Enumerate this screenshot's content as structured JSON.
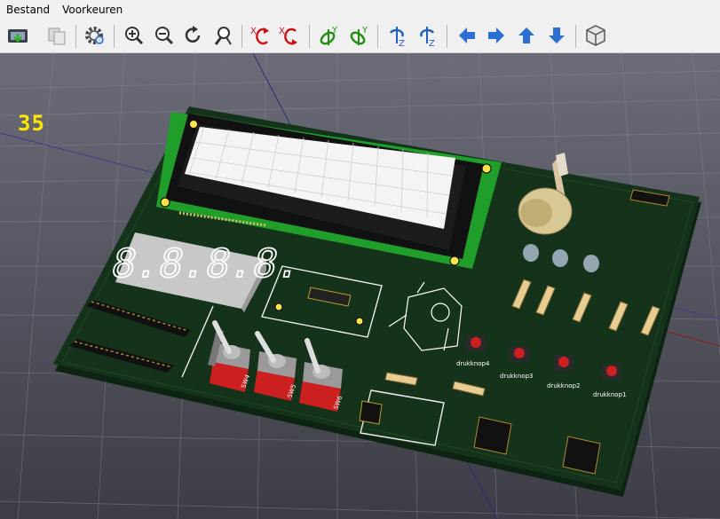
{
  "menu": {
    "items": [
      "Bestand",
      "Voorkeuren"
    ]
  },
  "toolbar": {
    "buttons": [
      {
        "name": "export-image-button",
        "icon": "export-image-icon"
      },
      {
        "name": "copy-button",
        "icon": "copy-icon"
      },
      {
        "name": "settings-button",
        "icon": "gear-icon"
      },
      {
        "name": "zoom-in-button",
        "icon": "zoom-in-icon"
      },
      {
        "name": "zoom-out-icon",
        "icon": "zoom-out-icon"
      },
      {
        "name": "redraw-button",
        "icon": "redraw-icon"
      },
      {
        "name": "zoom-fit-button",
        "icon": "zoom-fit-icon"
      },
      {
        "name": "rotate-x-cw-button",
        "icon": "rotate-x-cw-icon"
      },
      {
        "name": "rotate-x-ccw-button",
        "icon": "rotate-x-ccw-icon"
      },
      {
        "name": "rotate-y-cw-button",
        "icon": "rotate-y-cw-icon"
      },
      {
        "name": "rotate-y-ccw-button",
        "icon": "rotate-y-ccw-icon"
      },
      {
        "name": "rotate-z-cw-button",
        "icon": "rotate-z-cw-icon"
      },
      {
        "name": "rotate-z-ccw-button",
        "icon": "rotate-z-ccw-icon"
      },
      {
        "name": "move-left-button",
        "icon": "arrow-left-icon"
      },
      {
        "name": "move-right-button",
        "icon": "arrow-right-icon"
      },
      {
        "name": "move-up-button",
        "icon": "arrow-up-icon"
      },
      {
        "name": "move-down-button",
        "icon": "arrow-down-icon"
      },
      {
        "name": "ortho-view-button",
        "icon": "cube-icon"
      }
    ],
    "axis_letters": {
      "x": "X",
      "y": "Y",
      "z": "Z"
    }
  },
  "viewport": {
    "fps": "35",
    "seven_segment_text": "8.8.8.8.",
    "silkscreen_labels": [
      "drukknop4",
      "drukknop3",
      "drukknop2",
      "drukknop1",
      "SW4",
      "SW5",
      "SW6"
    ],
    "colors": {
      "background": "#585a66",
      "board": "#15321b",
      "lcd_pcb": "#1f9e2a",
      "silkscreen": "#ffffff",
      "button_cap": "#cc1f1f",
      "fps_text": "#ffe700"
    }
  }
}
